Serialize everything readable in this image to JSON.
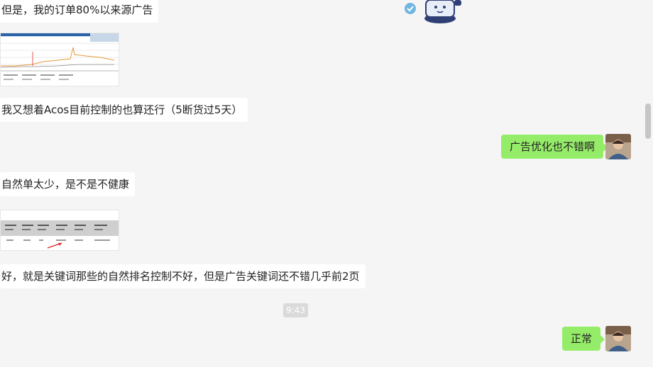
{
  "messages": [
    {
      "side": "left",
      "kind": "text",
      "text": "但是，我的订单80%以来源广告"
    },
    {
      "side": "left",
      "kind": "image",
      "image": "chart-screenshot"
    },
    {
      "side": "left",
      "kind": "text",
      "text": "我又想着Acos目前控制的也算还行（5断货过5天）"
    },
    {
      "side": "right",
      "kind": "text",
      "text": "广告优化也不错啊"
    },
    {
      "side": "left",
      "kind": "text",
      "text": "自然单太少，是不是不健康"
    },
    {
      "side": "left",
      "kind": "image",
      "image": "table-screenshot"
    },
    {
      "side": "left",
      "kind": "text",
      "text": "好，就是关键词那些的自然排名控制不好，但是广告关键词还不错几乎前2页"
    },
    {
      "side": "right",
      "kind": "text",
      "text": "正常"
    }
  ],
  "time_badge": "9:43",
  "colors": {
    "background": "#f5f5f5",
    "incoming_bubble": "#ffffff",
    "outgoing_bubble": "#95ec69",
    "time_badge": "#dadada"
  },
  "icons": {
    "sticker": "cartoon-character-sticker",
    "avatar": "user-avatar"
  }
}
